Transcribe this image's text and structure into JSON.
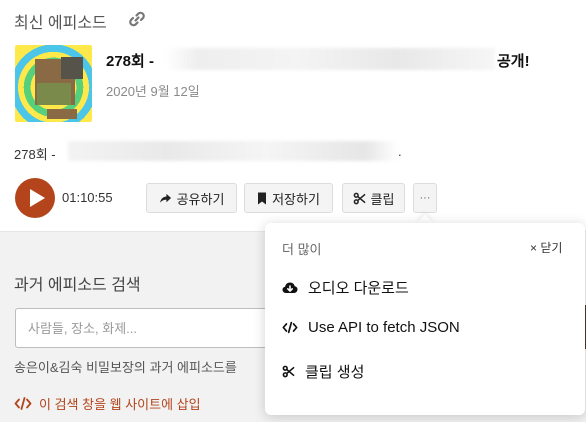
{
  "episode_section": {
    "title": "최신 에피소드",
    "icon": "link-icon",
    "episode": {
      "title_prefix": "278회 - ",
      "title_suffix": "공개!",
      "date": "2020년 9월 12일",
      "description_prefix": "278회 - ",
      "description_suffix": "."
    },
    "player": {
      "duration": "01:10:55",
      "accent_color": "#b3441c"
    },
    "actions": {
      "share_label": "공유하기",
      "save_label": "저장하기",
      "clip_label": "클립",
      "more_label": "···"
    }
  },
  "search_section": {
    "title": "과거 에피소드 검색",
    "placeholder": "사람들, 장소, 화제...",
    "note": "송은이&김숙 비밀보장의 과거 에피소드를",
    "embed_label": "이 검색 창을 웹 사이트에 삽입"
  },
  "more_popover": {
    "title": "더 많이",
    "close_label": "× 닫기",
    "items": [
      {
        "label": "오디오 다운로드",
        "icon": "cloud-download-icon"
      },
      {
        "label": "Use API to fetch JSON",
        "icon": "code-icon"
      },
      {
        "label": "클립 생성",
        "icon": "scissors-icon"
      }
    ]
  }
}
